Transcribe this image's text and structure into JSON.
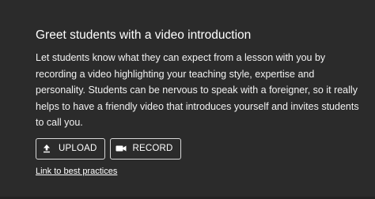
{
  "card": {
    "title": "Greet students with a video introduction",
    "description_lines": [
      "Let students know what they can expect from a lesson with you by",
      "recording a video highlighting your teaching style, expertise and",
      "personality. Students can be nervous to speak with a foreigner, so it really",
      "helps to have a friendly video that introduces yourself and invites students",
      "to call you."
    ],
    "upload_label": "UPLOAD",
    "upload_icon": "upload-icon",
    "record_label": "RECORD",
    "record_icon": "video-camera-icon",
    "link_label": "Link to best practices"
  },
  "colors": {
    "background": "#2b2b2b",
    "text": "#ffffff",
    "button_border": "#d9d9d9"
  }
}
